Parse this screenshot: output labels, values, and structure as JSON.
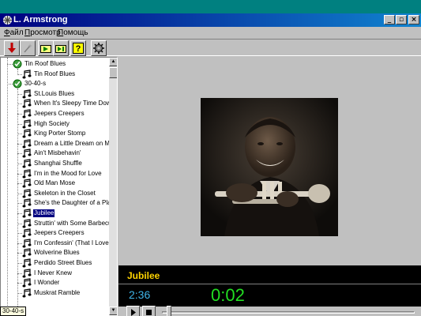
{
  "window": {
    "title": "L. Armstrong"
  },
  "menu": [
    {
      "label": "Файл",
      "hotkey": "Ф",
      "rest": "айл"
    },
    {
      "label": "Просмотр",
      "hotkey": "П",
      "rest": "росмотр"
    },
    {
      "label": "Помощь",
      "hotkey": "П",
      "rest": "омощь"
    }
  ],
  "toolbar": {
    "buttons": [
      "record-icon",
      "wand-icon",
      "play-folder-icon",
      "skip-folder-icon",
      "help-icon",
      "gear-icon"
    ]
  },
  "tree": {
    "items": [
      {
        "label": "Tin Roof Blues",
        "kind": "album"
      },
      {
        "label": "Tin Roof Blues",
        "kind": "track"
      },
      {
        "label": "30-40-s",
        "kind": "album"
      },
      {
        "label": "St.Louis Blues",
        "kind": "track"
      },
      {
        "label": "When It's Sleepy Time Down S",
        "kind": "track"
      },
      {
        "label": "Jeepers Creepers",
        "kind": "track"
      },
      {
        "label": "High Society",
        "kind": "track"
      },
      {
        "label": "King Porter Stomp",
        "kind": "track"
      },
      {
        "label": "Dream a Little Dream on Me",
        "kind": "track"
      },
      {
        "label": "Ain't Misbehavin'",
        "kind": "track"
      },
      {
        "label": "Shanghai Shuffle",
        "kind": "track"
      },
      {
        "label": "I'm in the Mood for Love",
        "kind": "track"
      },
      {
        "label": "Old Man Mose",
        "kind": "track"
      },
      {
        "label": "Skeleton in the Closet",
        "kind": "track"
      },
      {
        "label": "She's the Daughter of a Plante",
        "kind": "track"
      },
      {
        "label": "Jubilee",
        "kind": "track",
        "selected": true
      },
      {
        "label": "Struttin' with Some Barbecue",
        "kind": "track"
      },
      {
        "label": "Jeepers Creepers",
        "kind": "track"
      },
      {
        "label": "I'm Confessin' (That I Love Yo",
        "kind": "track"
      },
      {
        "label": "Wolverine Blues",
        "kind": "track"
      },
      {
        "label": "Perdido Street Blues",
        "kind": "track"
      },
      {
        "label": "I Never Knew",
        "kind": "track"
      },
      {
        "label": "I Wonder",
        "kind": "track"
      },
      {
        "label": "Muskrat Ramble",
        "kind": "track"
      }
    ]
  },
  "tooltip": "30-40-s",
  "player": {
    "track_title": "Jubilee",
    "total_time": "2:36",
    "current_time": "0:02",
    "position": 0.02
  },
  "colors": {
    "title_yellow": "#ffd400",
    "total_blue": "#3fb4e8",
    "current_green": "#22dd22",
    "titlebar": "#000080"
  }
}
